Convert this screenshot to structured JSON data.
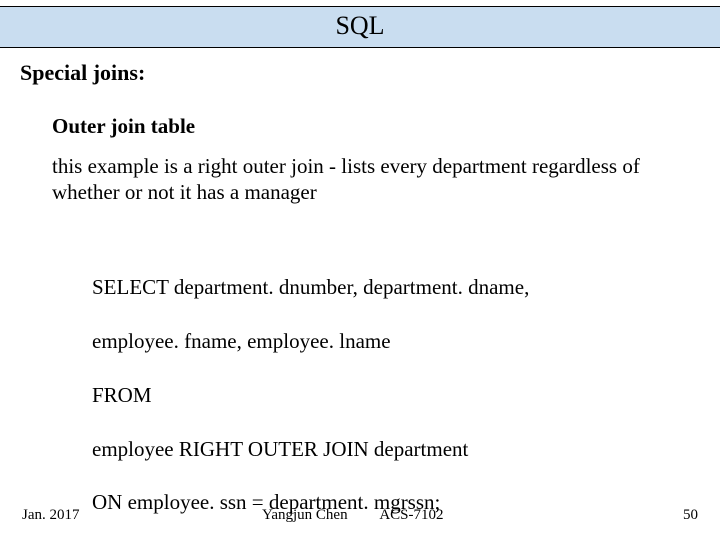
{
  "title": "SQL",
  "section_heading": "Special joins:",
  "sub_heading": "Outer join table",
  "paragraph": "this example is a right outer join - lists every department regardless of whether or not it has a manager",
  "code": {
    "l1": "SELECT department. dnumber, department. dname,",
    "l2": "employee. fname, employee. lname",
    "l3": "FROM",
    "l4": "employee RIGHT OUTER JOIN department",
    "l5": "ON employee. ssn = department. mgrssn;"
  },
  "footer": {
    "date": "Jan. 2017",
    "author": "Yangjun Chen",
    "course": "ACS-7102",
    "page": "50"
  }
}
